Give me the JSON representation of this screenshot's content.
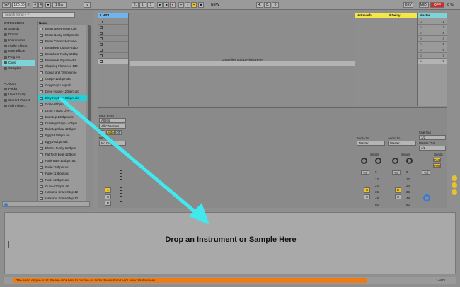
{
  "transport": {
    "tap": "TAP",
    "tempo": "120.00",
    "sig_num": "4",
    "sig_den": "4",
    "metro": "1 Bar",
    "pos1": "2.",
    "pos2": "1.",
    "pos3": "1",
    "pos4": "4.",
    "pos5": "0.",
    "pos6": "0",
    "new": "NEW",
    "key": "KEY",
    "midi": "MIDI",
    "cpu": "OFF",
    "pct": "0 %"
  },
  "browser": {
    "search_placeholder": "Search (Cmd + F)",
    "categories_title": "CATEGORIES",
    "categories": [
      "Sounds",
      "Drums",
      "Instruments",
      "Audio Effects",
      "MIDI Effects",
      "Plug-ins",
      "Clips",
      "Samples"
    ],
    "places_title": "PLACES",
    "places": [
      "Packs",
      "User Library",
      "Current Project",
      "Add Folder..."
    ],
    "name_header": "Name",
    "files": [
      "Break Booty-96bpm.alc",
      "Break Booty-130bpm.alc",
      "Break Classic Machine-",
      "Breakbeat Classic-92bp",
      "Breakbeat Funky-102bp",
      "Breakbeat Squashed-9",
      "Clapping Flamenco-130",
      "Conga and Tambourine",
      "Conga-120bpm.alc",
      "Copyshop Loop.alc",
      "Deep House-120bpm.alc",
      "Dirty Neptune-96bpm.alc",
      "Dolak-80bpm.alc",
      "Drum n Bass Live-174",
      "Dubstep-140bpm.alc",
      "Dubstep Claps-140bpm",
      "Dubstep Slow-120bpm",
      "Egypt-108bpm.alc",
      "Egypt-92bpm.alc",
      "Electro Funky-120bpm",
      "Fat Tech Beat-128bpm",
      "Funk Hats-120bpm.alc",
      "Funk-110bpm.alc",
      "Funk-113bpm.alc",
      "Funk-120bpm.alc",
      "Guiro-110bpm.alc",
      "Hats and Snare Step-12",
      "Hats and Snare Step-12",
      "High Hats with Reverse"
    ]
  },
  "tracks": {
    "midi": "1 MIDI",
    "reverb": "A Reverb",
    "delay": "B Delay",
    "master": "Master",
    "drop_text": "Drop Files and Devices Here",
    "scene_numbers": [
      "1",
      "2",
      "3",
      "4",
      "5",
      "6",
      "7",
      "8"
    ]
  },
  "mixer": {
    "midi_from": "MIDI From",
    "all_ins": "All Ins",
    "all_channels": "All Channels",
    "monitor_in": "In",
    "monitor_auto": "Auto",
    "monitor_off": "Off",
    "midi_to": "MIDI To",
    "no_output": "No Output",
    "audio_to": "Audio To",
    "master_sel": "Master",
    "sends": "Sends",
    "cue_out": "Cue Out",
    "cue_val": "1/2",
    "master_out": "Master Out",
    "master_out_val": "1/2",
    "track_num": "1",
    "solo": "S",
    "rec": "R",
    "a": "A",
    "b": "B",
    "post": "Post",
    "inf": "-Inf",
    "db_marks": [
      "12",
      "24",
      "36",
      "48",
      "60"
    ],
    "zero": "0"
  },
  "detail": {
    "drop_text": "Drop an Instrument or Sample Here",
    "track_label": "1-MIDI"
  },
  "status": {
    "message": "The audio engine is off. Please click here to choose an audio device from Live's Audio Preferences."
  },
  "colors": {
    "midi_track": "#6db5f0",
    "reverb_track": "#f5e64a",
    "delay_track": "#f5e64a",
    "master_track": "#7ed3d8",
    "selected_file": "#1fd1d8",
    "arrow": "#43e8ef",
    "status_bar": "#f07b14"
  }
}
